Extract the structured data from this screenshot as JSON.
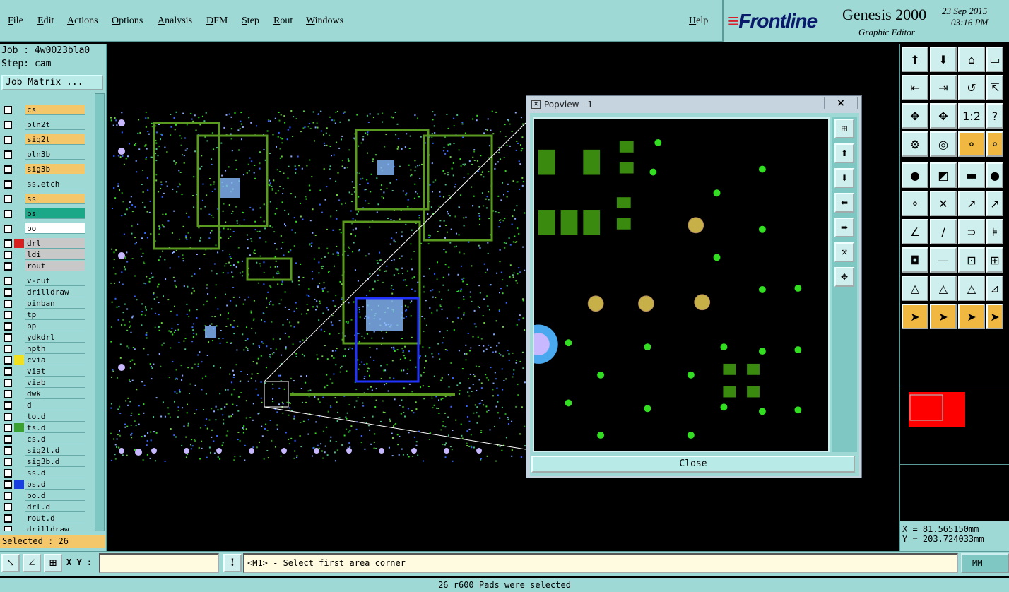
{
  "menu": [
    "File",
    "Edit",
    "Actions",
    "Options",
    "Analysis",
    "DFM",
    "Step",
    "Rout",
    "Windows"
  ],
  "help_label": "Help",
  "brand": {
    "logo": "Frontline",
    "title": "Genesis 2000",
    "subtitle": "Graphic Editor",
    "date": "23 Sep 2015",
    "time": "03:16 PM"
  },
  "job": {
    "job_line": "Job : 4w0023bla0",
    "step_line": "Step: cam",
    "matrix_button": "Job Matrix ..."
  },
  "layers": [
    {
      "name": "cs",
      "color": "#f4c76a",
      "mark": ""
    },
    {
      "name": "pln2t",
      "color": "#9fd9d6",
      "mark": ""
    },
    {
      "name": "sig2t",
      "color": "#f4c76a",
      "mark": ""
    },
    {
      "name": "pln3b",
      "color": "#9fd9d6",
      "mark": ""
    },
    {
      "name": "sig3b",
      "color": "#f4c76a",
      "mark": ""
    },
    {
      "name": "ss.etch",
      "color": "#9fd9d6",
      "mark": ""
    },
    {
      "name": "ss",
      "color": "#f4c76a",
      "mark": ""
    },
    {
      "name": "bs",
      "color": "#1aa888",
      "mark": ""
    },
    {
      "name": "bo",
      "color": "#ffffff",
      "mark": ""
    },
    {
      "name": "drl",
      "color": "#c8c8c8",
      "mark": "#d82020"
    },
    {
      "name": "ldi",
      "color": "#c8c8c8",
      "mark": ""
    },
    {
      "name": "rout",
      "color": "#c8c8c8",
      "mark": ""
    },
    {
      "name": "v-cut",
      "color": "#9fd9d6",
      "mark": ""
    },
    {
      "name": "drilldraw",
      "color": "#9fd9d6",
      "mark": ""
    },
    {
      "name": "pinban",
      "color": "#9fd9d6",
      "mark": ""
    },
    {
      "name": "tp",
      "color": "#9fd9d6",
      "mark": ""
    },
    {
      "name": "bp",
      "color": "#9fd9d6",
      "mark": ""
    },
    {
      "name": "ydkdrl",
      "color": "#9fd9d6",
      "mark": ""
    },
    {
      "name": "npth",
      "color": "#9fd9d6",
      "mark": ""
    },
    {
      "name": "cvia",
      "color": "#9fd9d6",
      "mark": "#f0e020"
    },
    {
      "name": "viat",
      "color": "#9fd9d6",
      "mark": ""
    },
    {
      "name": "viab",
      "color": "#9fd9d6",
      "mark": ""
    },
    {
      "name": "dwk",
      "color": "#9fd9d6",
      "mark": ""
    },
    {
      "name": "d",
      "color": "#9fd9d6",
      "mark": ""
    },
    {
      "name": "to.d",
      "color": "#9fd9d6",
      "mark": ""
    },
    {
      "name": "ts.d",
      "color": "#9fd9d6",
      "mark": "#3aa030"
    },
    {
      "name": "cs.d",
      "color": "#9fd9d6",
      "mark": ""
    },
    {
      "name": "sig2t.d",
      "color": "#9fd9d6",
      "mark": ""
    },
    {
      "name": "sig3b.d",
      "color": "#9fd9d6",
      "mark": ""
    },
    {
      "name": "ss.d",
      "color": "#9fd9d6",
      "mark": ""
    },
    {
      "name": "bs.d",
      "color": "#9fd9d6",
      "mark": "#1840e0"
    },
    {
      "name": "bo.d",
      "color": "#9fd9d6",
      "mark": ""
    },
    {
      "name": "drl.d",
      "color": "#9fd9d6",
      "mark": ""
    },
    {
      "name": "rout.d",
      "color": "#9fd9d6",
      "mark": ""
    },
    {
      "name": "drilldraw.",
      "color": "#9fd9d6",
      "mark": ""
    }
  ],
  "selected_text": "Selected : 26",
  "popview": {
    "title": "Popview - 1",
    "close_x": "×",
    "close_button": "Close"
  },
  "coords": {
    "x": "X = 81.565150mm",
    "y": "Y = 203.724033mm"
  },
  "bottom": {
    "xy_label": "X Y :",
    "xy_value": "",
    "warn": "!",
    "prompt": "<M1> - Select first area corner",
    "units": "MM"
  },
  "status": "26 r600 Pads were selected",
  "colors": {
    "panel": "#9fd9d6",
    "highlight": "#f4c76a",
    "pad_green": "#3a8a10",
    "via": "#33dd22",
    "pad_gold": "#c8b048"
  }
}
